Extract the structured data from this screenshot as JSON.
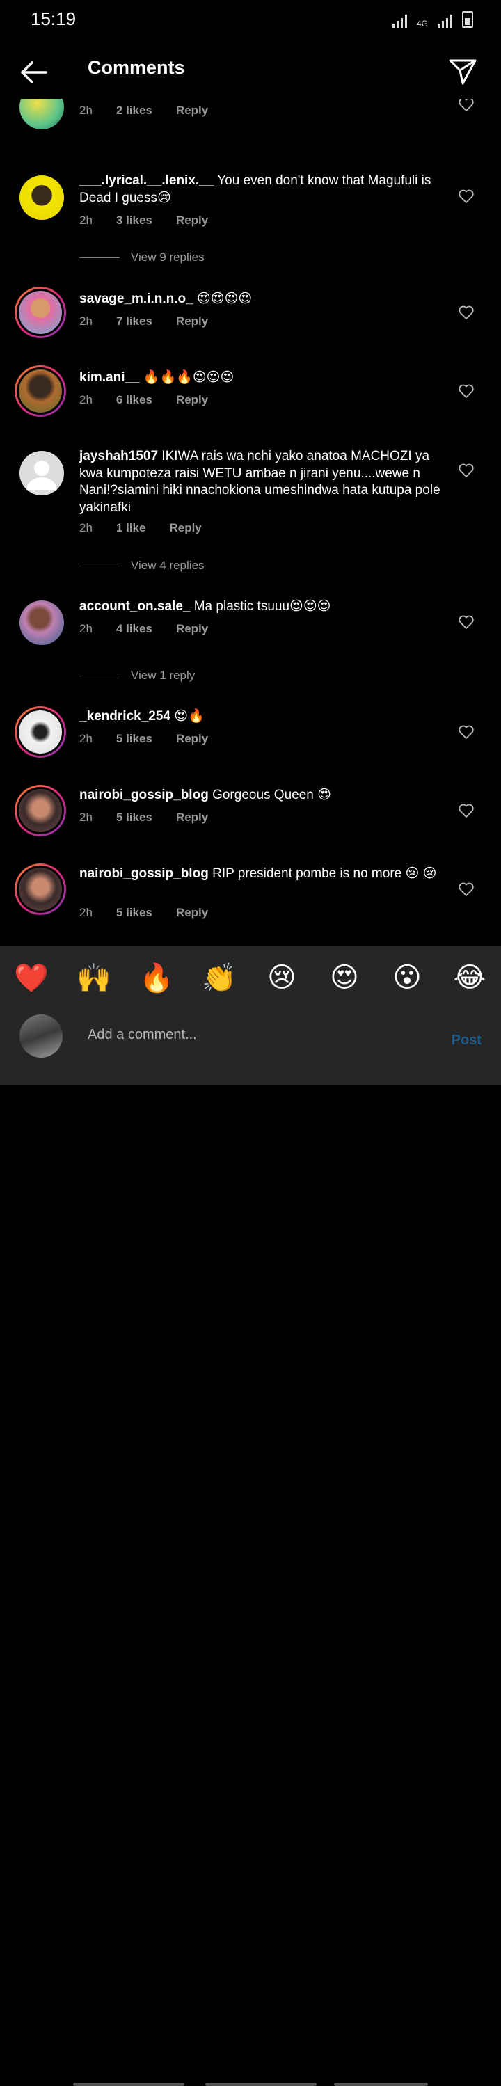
{
  "status": {
    "time": "15:19",
    "network": "4G"
  },
  "header": {
    "title": "Comments"
  },
  "partial_comment": {
    "time": "2h",
    "likes": "2 likes",
    "reply": "Reply"
  },
  "comments": [
    {
      "user": "___.lyrical.__.lenix.__",
      "text": " You even don't know that Magufuli is Dead I guess😢",
      "time": "2h",
      "likes": "3 likes",
      "reply": "Reply"
    },
    {
      "user": "savage_m.i.n.n.o_",
      "text": " 😍😍😍😍",
      "time": "2h",
      "likes": "7 likes",
      "reply": "Reply"
    },
    {
      "user": "kim.ani__",
      "text": " 🔥🔥🔥😍😍😍",
      "time": "2h",
      "likes": "6 likes",
      "reply": "Reply"
    },
    {
      "user": "jayshah1507",
      "text": " IKIWA rais wa nchi yako anatoa MACHOZI ya kwa kumpoteza raisi WETU ambae n jirani yenu....wewe n Nani!?siamini hiki nnachokiona umeshindwa hata kutupa pole  yakinafki",
      "time": "2h",
      "likes": "1 like",
      "reply": "Reply"
    },
    {
      "user": "account_on.sale_",
      "text": " Ma plastic tsuuu😍😍😍",
      "time": "2h",
      "likes": "4 likes",
      "reply": "Reply"
    },
    {
      "user": "_kendrick_254",
      "text": " 😍🔥",
      "time": "2h",
      "likes": "5 likes",
      "reply": "Reply"
    },
    {
      "user": "nairobi_gossip_blog",
      "text": " Gorgeous Queen 😍",
      "time": "2h",
      "likes": "5 likes",
      "reply": "Reply"
    },
    {
      "user": "nairobi_gossip_blog",
      "text": " RIP president pombe is no more 😢 😢",
      "time": "2h",
      "likes": "5 likes",
      "reply": "Reply"
    }
  ],
  "view_replies": [
    "View 9 replies",
    "View 4 replies",
    "View 1 reply"
  ],
  "emoji_bar": [
    "❤️",
    "🙌",
    "🔥",
    "👏",
    "😢",
    "😍",
    "😮",
    "😂"
  ],
  "compose": {
    "placeholder": "Add a comment...",
    "post": "Post"
  },
  "colors": {
    "background": "#000000",
    "secondary_text": "#9a9a9a",
    "post_disabled": "#1c5d8c",
    "story_ring": "#dd2a7b"
  }
}
